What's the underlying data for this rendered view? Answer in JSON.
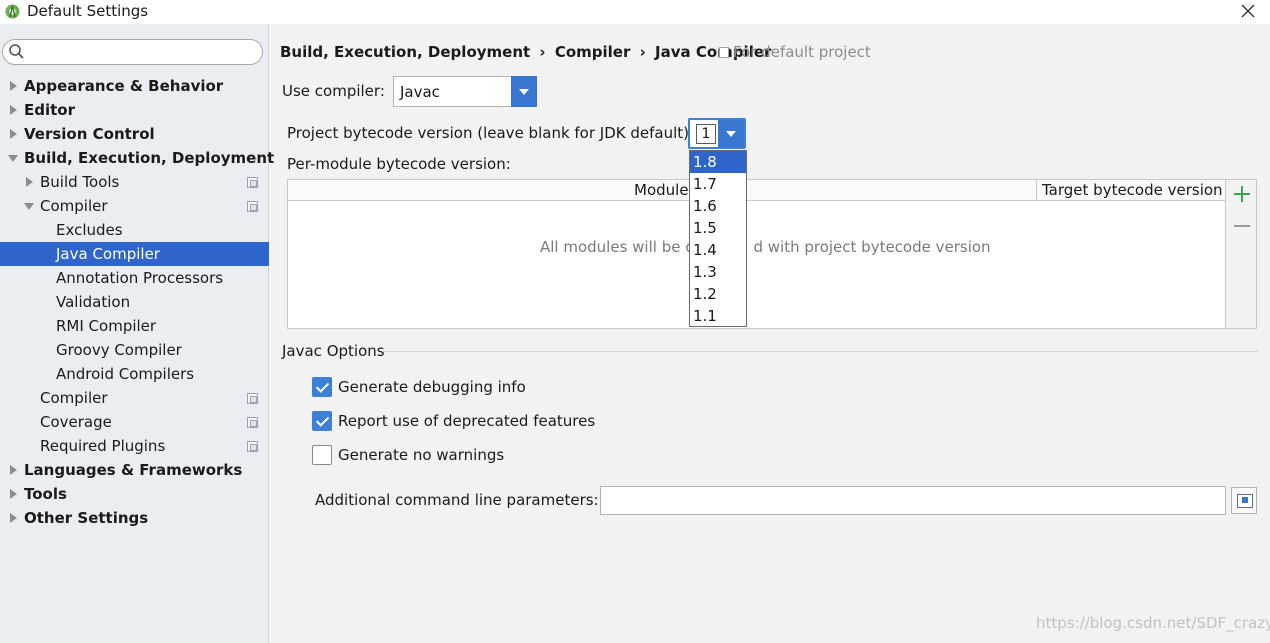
{
  "window": {
    "title": "Default Settings"
  },
  "sidebar": {
    "items": [
      {
        "label": "Appearance & Behavior"
      },
      {
        "label": "Editor"
      },
      {
        "label": "Version Control"
      },
      {
        "label": "Build, Execution, Deployment"
      },
      {
        "label": "Build Tools"
      },
      {
        "label": "Compiler"
      },
      {
        "label": "Excludes"
      },
      {
        "label": "Java Compiler"
      },
      {
        "label": "Annotation Processors"
      },
      {
        "label": "Validation"
      },
      {
        "label": "RMI Compiler"
      },
      {
        "label": "Groovy Compiler"
      },
      {
        "label": "Android Compilers"
      },
      {
        "label": "Compiler"
      },
      {
        "label": "Coverage"
      },
      {
        "label": "Required Plugins"
      },
      {
        "label": "Languages & Frameworks"
      },
      {
        "label": "Tools"
      },
      {
        "label": "Other Settings"
      }
    ]
  },
  "breadcrumb": {
    "parts": [
      "Build, Execution, Deployment",
      "Compiler",
      "Java Compiler"
    ],
    "separator": "›",
    "scope": "For default project"
  },
  "compiler": {
    "label": "Use compiler:",
    "value": "Javac"
  },
  "bytecode": {
    "label": "Project bytecode version (leave blank for JDK default):",
    "value": "1",
    "options": [
      "1.8",
      "1.7",
      "1.6",
      "1.5",
      "1.4",
      "1.3",
      "1.2",
      "1.1"
    ],
    "highlighted": "1.8"
  },
  "per_module": {
    "label": "Per-module bytecode version:",
    "col_module": "Module",
    "col_target": "Target bytecode version",
    "empty_before": "All modules will be c",
    "empty_after": "d with project bytecode version"
  },
  "javac": {
    "title": "Javac Options",
    "options": [
      {
        "label": "Generate debugging info",
        "checked": true
      },
      {
        "label": "Report use of deprecated features",
        "checked": true
      },
      {
        "label": "Generate no warnings",
        "checked": false
      }
    ],
    "cmd_label": "Additional command line parameters:",
    "cmd_value": ""
  },
  "watermark": "https://blog.csdn.net/SDF_crazy",
  "colors": {
    "selection": "#2f65ca",
    "accent": "#3877d1",
    "add_green": "#38a64a"
  }
}
